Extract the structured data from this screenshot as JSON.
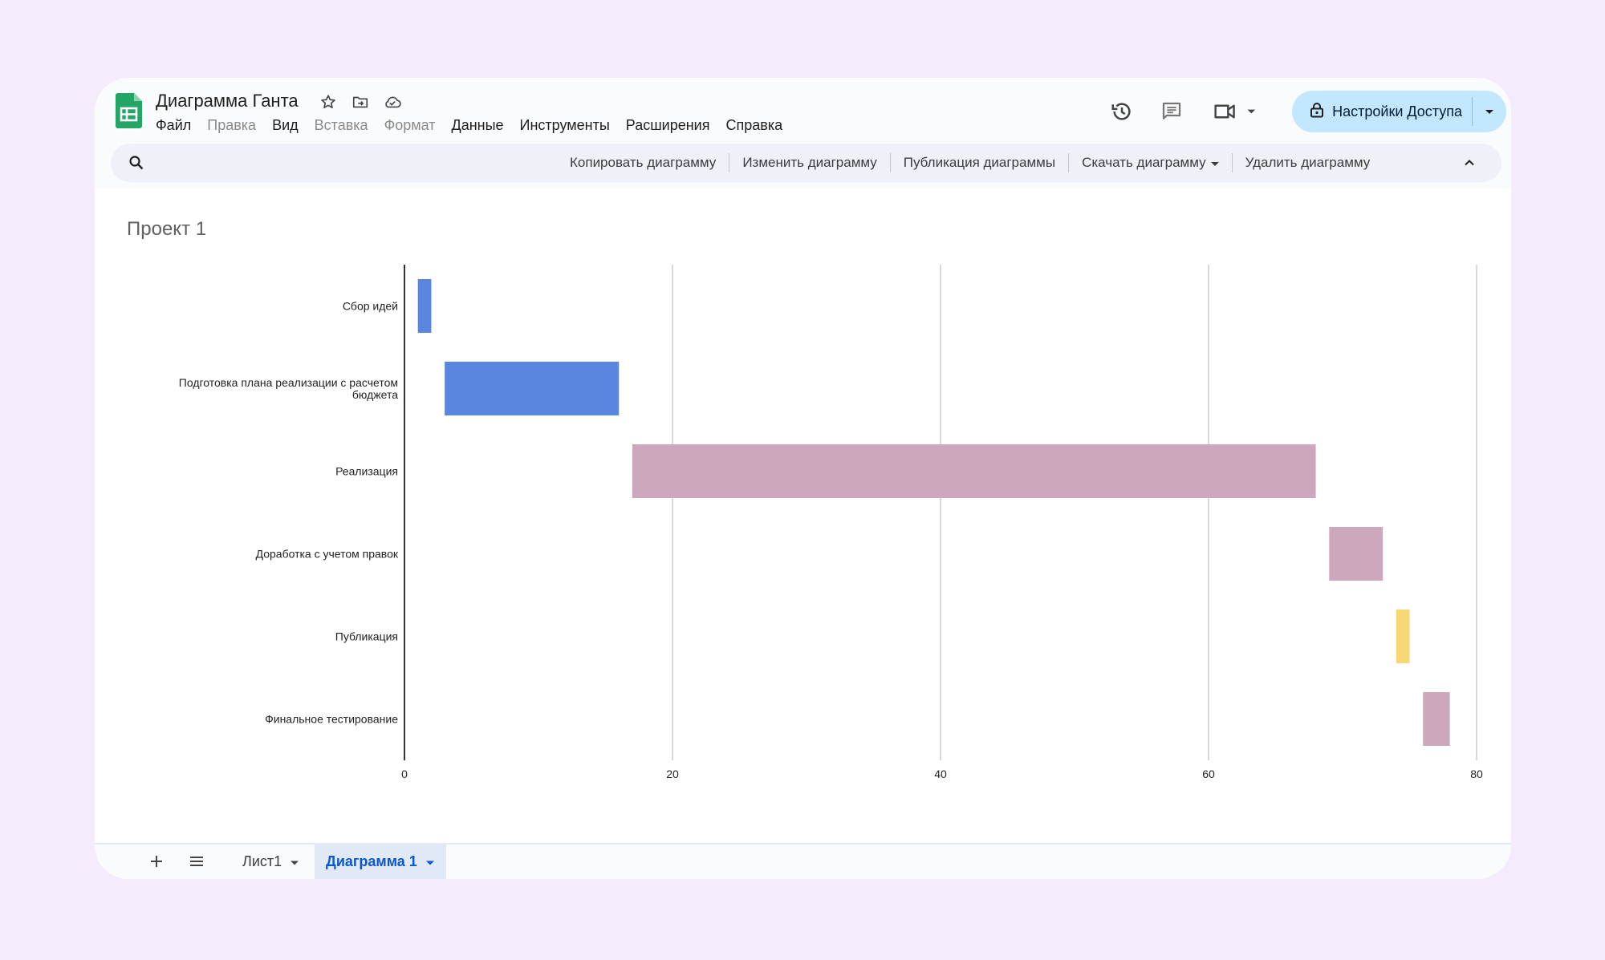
{
  "app": {
    "document_title": "Диаграмма Ганта",
    "menu": [
      {
        "label": "Файл",
        "enabled": true
      },
      {
        "label": "Правка",
        "enabled": false
      },
      {
        "label": "Вид",
        "enabled": true
      },
      {
        "label": "Вставка",
        "enabled": false
      },
      {
        "label": "Формат",
        "enabled": false
      },
      {
        "label": "Данные",
        "enabled": true
      },
      {
        "label": "Инструменты",
        "enabled": true
      },
      {
        "label": "Расширения",
        "enabled": true
      },
      {
        "label": "Справка",
        "enabled": true
      }
    ],
    "share_label": "Настройки Доступа"
  },
  "chart_toolbar": {
    "copy": "Копировать диаграмму",
    "edit": "Изменить диаграмму",
    "publish": "Публикация диаграммы",
    "download": "Скачать диаграмму",
    "delete": "Удалить диаграмму"
  },
  "sheets": [
    {
      "label": "Лист1",
      "active": false
    },
    {
      "label": "Диаграмма 1",
      "active": true
    }
  ],
  "colors": {
    "blue": "#5b86e0",
    "mauve": "#cda8bd",
    "yellow": "#f6d976",
    "share_bg": "#c2e7ff",
    "active_tab": "#0b57d0"
  },
  "chart_data": {
    "type": "gantt",
    "title": "Проект 1",
    "xlim": [
      0,
      80
    ],
    "xticks": [
      0,
      20,
      40,
      60,
      80
    ],
    "grid": true,
    "legend": "none",
    "tasks": [
      {
        "label": "Сбор идей",
        "start": 1,
        "end": 2,
        "color": "#5b86e0"
      },
      {
        "label": "Подготовка плана реализации с расчетом бюджета",
        "start": 3,
        "end": 16,
        "color": "#5b86e0"
      },
      {
        "label": "Реализация",
        "start": 17,
        "end": 68,
        "color": "#cda8bd"
      },
      {
        "label": "Доработка с учетом правок",
        "start": 69,
        "end": 73,
        "color": "#cda8bd"
      },
      {
        "label": "Публикация",
        "start": 74,
        "end": 75,
        "color": "#f6d976"
      },
      {
        "label": "Финальное тестирование",
        "start": 76,
        "end": 78,
        "color": "#cda8bd"
      }
    ]
  }
}
